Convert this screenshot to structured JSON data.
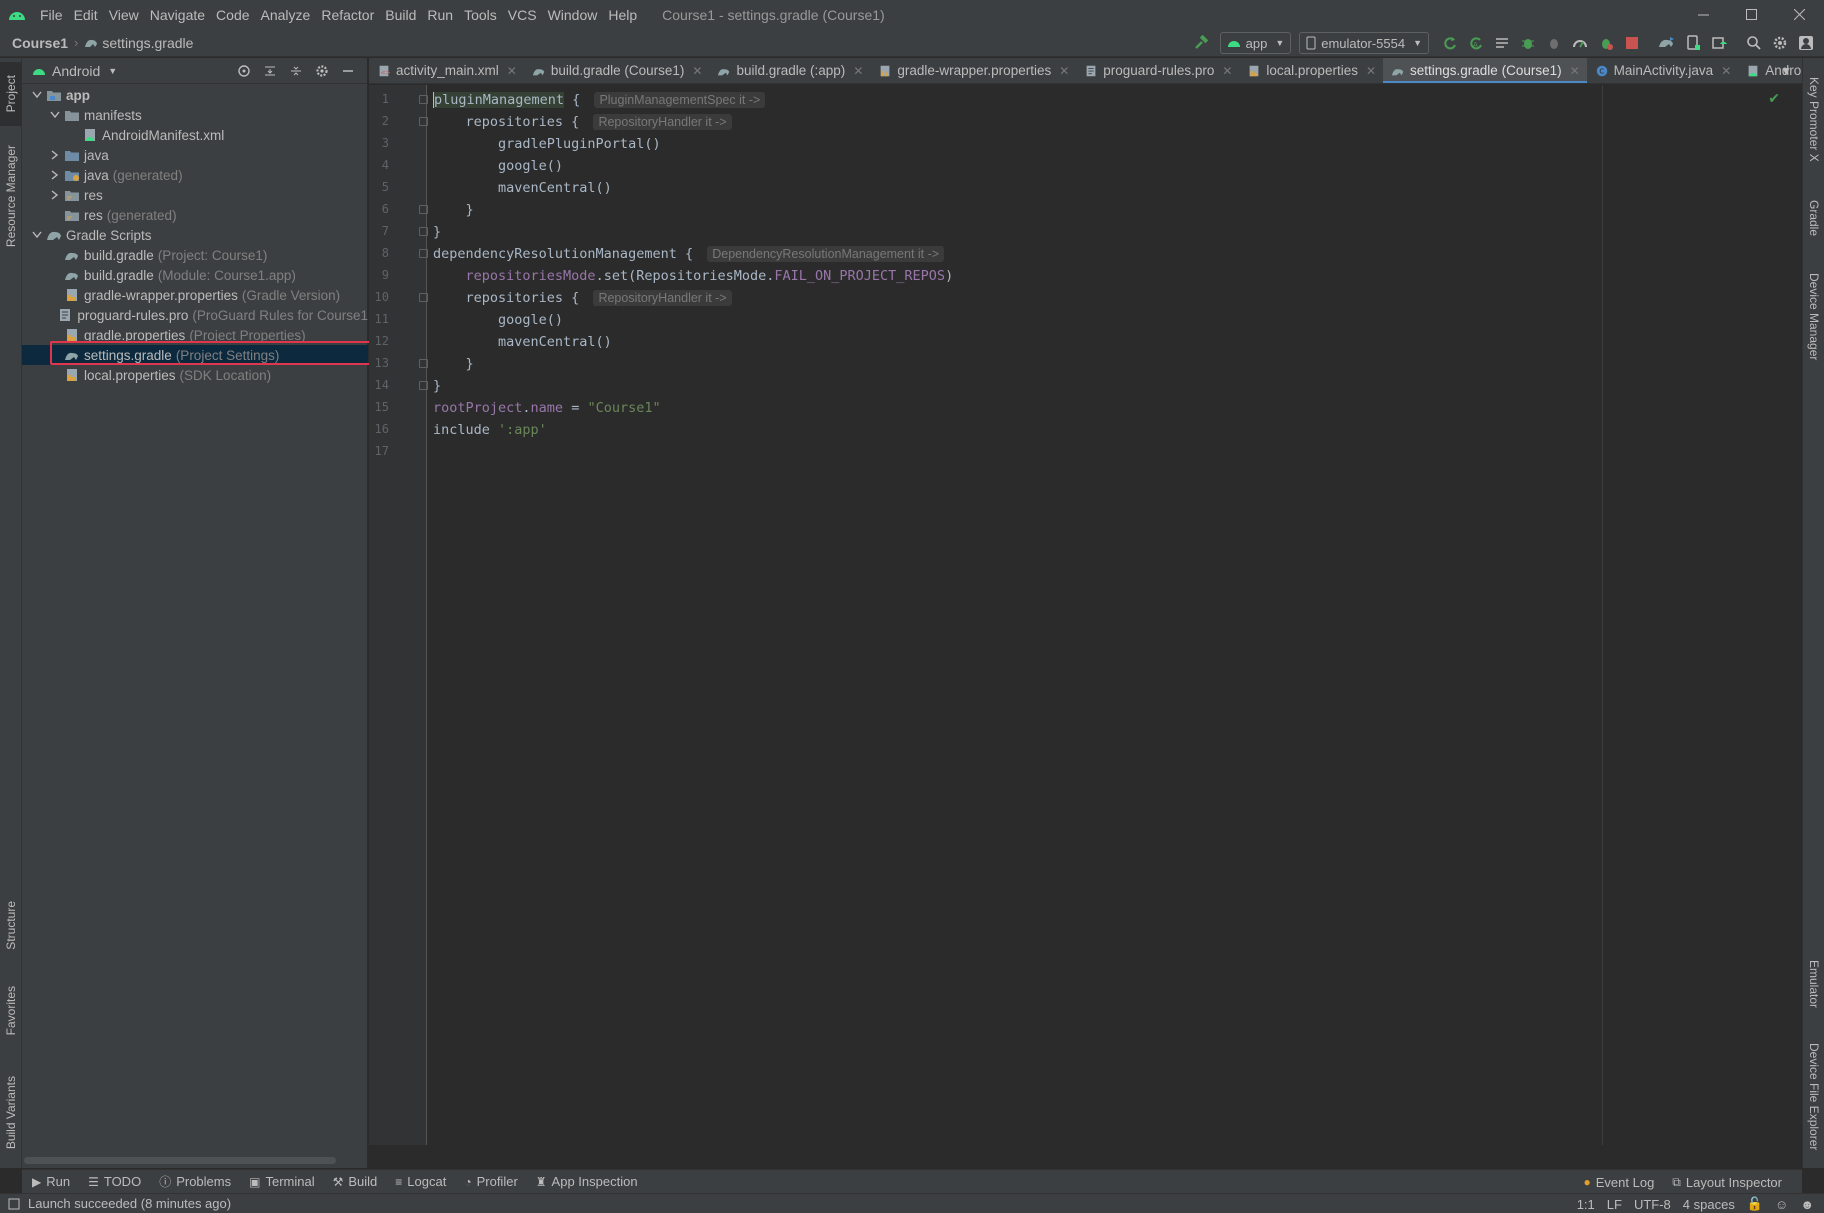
{
  "window": {
    "title": "Course1 - settings.gradle (Course1)",
    "menu": [
      "File",
      "Edit",
      "View",
      "Navigate",
      "Code",
      "Analyze",
      "Refactor",
      "Build",
      "Run",
      "Tools",
      "VCS",
      "Window",
      "Help"
    ]
  },
  "navbar": {
    "project": "Course1",
    "file": "settings.gradle",
    "run_config": "app",
    "device": "emulator-5554"
  },
  "left_stripe": {
    "project": "Project",
    "resource_manager": "Resource Manager",
    "structure": "Structure",
    "favorites": "Favorites",
    "build_variants": "Build Variants"
  },
  "right_stripe": {
    "key_promoter": "Key Promoter X",
    "gradle": "Gradle",
    "device_manager": "Device Manager",
    "emulator": "Emulator",
    "device_file_explorer": "Device File Explorer"
  },
  "project_panel": {
    "view": "Android",
    "tree": [
      {
        "label": "app",
        "hint": "",
        "depth": 0,
        "arrow": "down",
        "icon": "app-module-icon",
        "bold": true
      },
      {
        "label": "manifests",
        "hint": "",
        "depth": 1,
        "arrow": "down",
        "icon": "folder-icon"
      },
      {
        "label": "AndroidManifest.xml",
        "hint": "",
        "depth": 2,
        "arrow": "none",
        "icon": "manifest-file-icon"
      },
      {
        "label": "java",
        "hint": "",
        "depth": 1,
        "arrow": "right",
        "icon": "java-folder-icon"
      },
      {
        "label": "java",
        "hint": "(generated)",
        "depth": 1,
        "arrow": "right",
        "icon": "generated-folder-icon"
      },
      {
        "label": "res",
        "hint": "",
        "depth": 1,
        "arrow": "right",
        "icon": "res-folder-icon"
      },
      {
        "label": "res",
        "hint": "(generated)",
        "depth": 1,
        "arrow": "none",
        "icon": "res-folder-icon"
      },
      {
        "label": "Gradle Scripts",
        "hint": "",
        "depth": 0,
        "arrow": "down",
        "icon": "gradle-icon"
      },
      {
        "label": "build.gradle",
        "hint": "(Project: Course1)",
        "depth": 1,
        "arrow": "none",
        "icon": "gradle-file-icon"
      },
      {
        "label": "build.gradle",
        "hint": "(Module: Course1.app)",
        "depth": 1,
        "arrow": "none",
        "icon": "gradle-file-icon"
      },
      {
        "label": "gradle-wrapper.properties",
        "hint": "(Gradle Version)",
        "depth": 1,
        "arrow": "none",
        "icon": "properties-file-icon"
      },
      {
        "label": "proguard-rules.pro",
        "hint": "(ProGuard Rules for Course1",
        "depth": 1,
        "arrow": "none",
        "icon": "text-file-icon"
      },
      {
        "label": "gradle.properties",
        "hint": "(Project Properties)",
        "depth": 1,
        "arrow": "none",
        "icon": "properties-file-icon"
      },
      {
        "label": "settings.gradle",
        "hint": "(Project Settings)",
        "depth": 1,
        "arrow": "none",
        "icon": "gradle-file-icon",
        "selected": true
      },
      {
        "label": "local.properties",
        "hint": "(SDK Location)",
        "depth": 1,
        "arrow": "none",
        "icon": "properties-file-icon"
      }
    ]
  },
  "tabs": [
    {
      "label": "activity_main.xml",
      "icon": "xml-file-icon",
      "active": false
    },
    {
      "label": "build.gradle (Course1)",
      "icon": "gradle-file-icon",
      "active": false
    },
    {
      "label": "build.gradle (:app)",
      "icon": "gradle-file-icon",
      "active": false
    },
    {
      "label": "gradle-wrapper.properties",
      "icon": "properties-file-icon",
      "active": false
    },
    {
      "label": "proguard-rules.pro",
      "icon": "text-file-icon",
      "active": false
    },
    {
      "label": "local.properties",
      "icon": "properties-file-icon",
      "active": false
    },
    {
      "label": "settings.gradle (Course1)",
      "icon": "gradle-file-icon",
      "active": true
    },
    {
      "label": "MainActivity.java",
      "icon": "java-class-icon",
      "active": false
    },
    {
      "label": "Androi",
      "icon": "manifest-file-icon",
      "active": false
    }
  ],
  "editor": {
    "lines": [
      {
        "n": "1",
        "html": "<span class=\"caret\"></span><span class=\"hl\">pluginManagement</span> { <span class=\"inlay\">PluginManagementSpec it -&gt;</span>"
      },
      {
        "n": "2",
        "html": "    repositories { <span class=\"inlay\">RepositoryHandler it -&gt;</span>"
      },
      {
        "n": "3",
        "html": "        gradlePluginPortal()"
      },
      {
        "n": "4",
        "html": "        google()"
      },
      {
        "n": "5",
        "html": "        mavenCentral()"
      },
      {
        "n": "6",
        "html": "    }"
      },
      {
        "n": "7",
        "html": "}"
      },
      {
        "n": "8",
        "html": "dependencyResolutionManagement { <span class=\"inlay\">DependencyResolutionManagement it -&gt;</span>"
      },
      {
        "n": "9",
        "html": "    <span class=\"prop\">repositoriesMode</span>.set(RepositoriesMode.<span class=\"prop\">FAIL_ON_PROJECT_REPOS</span>)"
      },
      {
        "n": "10",
        "html": "    repositories { <span class=\"inlay\">RepositoryHandler it -&gt;</span>"
      },
      {
        "n": "11",
        "html": "        google()"
      },
      {
        "n": "12",
        "html": "        mavenCentral()"
      },
      {
        "n": "13",
        "html": "    }"
      },
      {
        "n": "14",
        "html": "}"
      },
      {
        "n": "15",
        "html": "<span class=\"prop\">rootProject</span>.<span class=\"prop\">name</span> = <span class=\"str\">\"Course1\"</span>"
      },
      {
        "n": "16",
        "html": "include <span class=\"str\">':app'</span>"
      },
      {
        "n": "17",
        "html": ""
      }
    ]
  },
  "toolwindows": {
    "left": [
      "Run",
      "TODO",
      "Problems",
      "Terminal",
      "Build",
      "Logcat",
      "Profiler",
      "App Inspection"
    ],
    "right": [
      "Event Log",
      "Layout Inspector"
    ]
  },
  "status": {
    "message": "Launch succeeded (8 minutes ago)",
    "position": "1:1",
    "line_sep": "LF",
    "encoding": "UTF-8",
    "indent": "4 spaces"
  },
  "colors": {
    "accent": "#4a88c7",
    "selection_outline": "#e0364d",
    "android_green": "#3ddc84"
  }
}
